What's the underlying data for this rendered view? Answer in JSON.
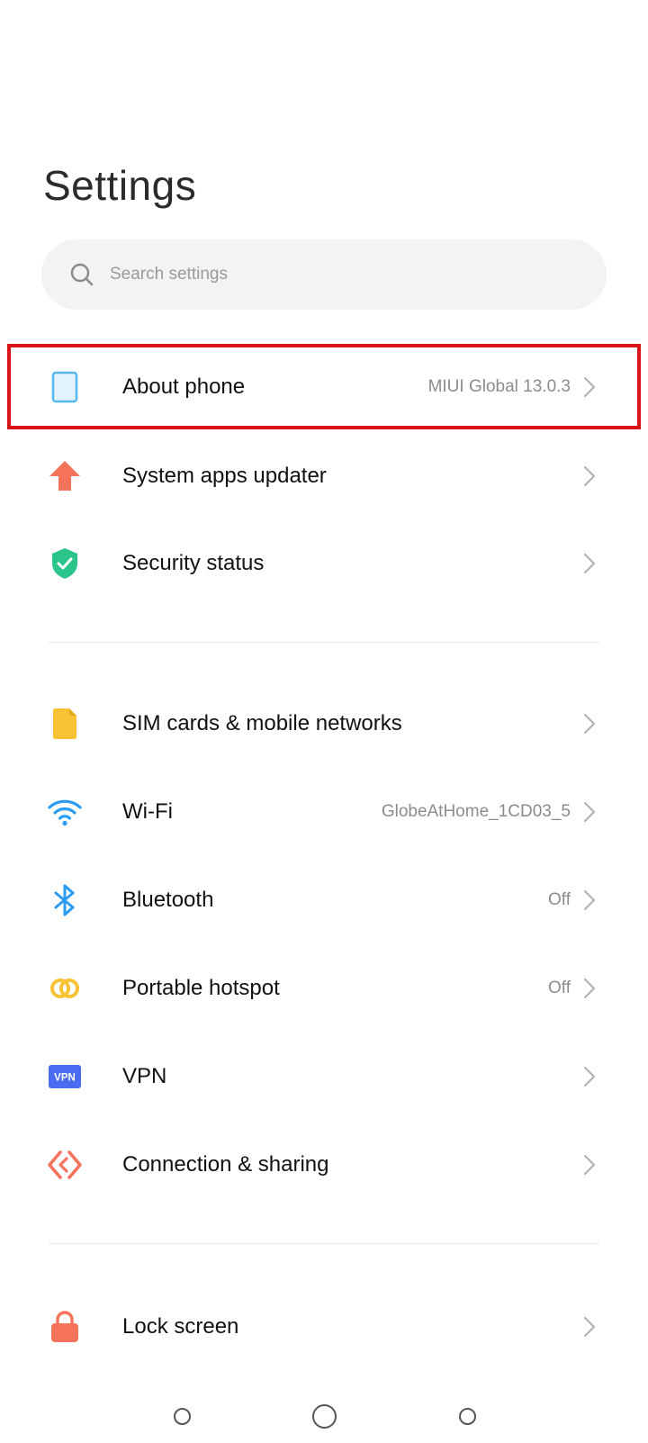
{
  "header": {
    "title": "Settings"
  },
  "search": {
    "placeholder": "Search settings",
    "icon": "search-icon"
  },
  "sections": [
    {
      "items": [
        {
          "id": "about-phone",
          "label": "About phone",
          "value": "MIUI Global 13.0.3",
          "icon": "phone-icon",
          "color": "#56b6f2",
          "highlighted": true
        },
        {
          "id": "system-apps-updater",
          "label": "System apps updater",
          "value": "",
          "icon": "arrow-up-icon",
          "color": "#f4735a"
        },
        {
          "id": "security-status",
          "label": "Security status",
          "value": "",
          "icon": "shield-check-icon",
          "color": "#2bc48a"
        }
      ]
    },
    {
      "items": [
        {
          "id": "sim-cards",
          "label": "SIM cards & mobile networks",
          "value": "",
          "icon": "sim-card-icon",
          "color": "#f7c234"
        },
        {
          "id": "wifi",
          "label": "Wi-Fi",
          "value": "GlobeAtHome_1CD03_5",
          "icon": "wifi-icon",
          "color": "#2b9cf2"
        },
        {
          "id": "bluetooth",
          "label": "Bluetooth",
          "value": "Off",
          "icon": "bluetooth-icon",
          "color": "#2b9cf2"
        },
        {
          "id": "portable-hotspot",
          "label": "Portable hotspot",
          "value": "Off",
          "icon": "hotspot-icon",
          "color": "#f7c234"
        },
        {
          "id": "vpn",
          "label": "VPN",
          "value": "",
          "icon": "vpn-icon",
          "icon_text": "VPN",
          "color": "#4a6cf0"
        },
        {
          "id": "connection-sharing",
          "label": "Connection & sharing",
          "value": "",
          "icon": "connection-sharing-icon",
          "color": "#f4735a"
        }
      ]
    },
    {
      "items": [
        {
          "id": "lock-screen",
          "label": "Lock screen",
          "value": "",
          "icon": "lock-icon",
          "color": "#f4735a"
        }
      ]
    }
  ],
  "navbar": {
    "buttons": [
      "recents-button",
      "home-button",
      "back-button"
    ]
  }
}
